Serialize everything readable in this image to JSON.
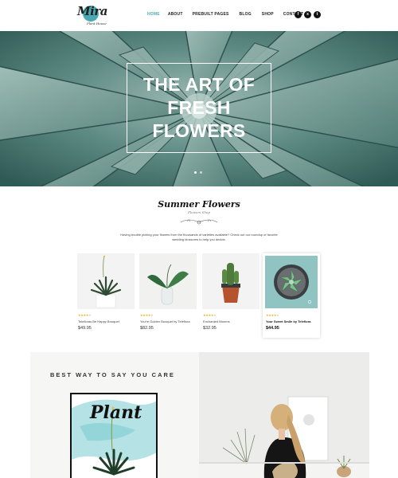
{
  "header": {
    "logo_text": "Mira",
    "logo_sub": "Plant House",
    "nav": [
      "HOME",
      "ABOUT",
      "PREBUILT PAGES",
      "BLOG",
      "SHOP",
      "CONTACT"
    ],
    "social_icons": [
      "facebook-icon",
      "xing-icon",
      "twitter-icon"
    ]
  },
  "hero": {
    "title": "THE ART OF FRESH FLOWERS",
    "slide_count": 2,
    "active_slide": 1
  },
  "summer": {
    "title": "Summer Flowers",
    "subtitle": "Flowers Shop",
    "description": "Having trouble picking your flowers from the thousands of varieties available? Check out our roundup of favorite wedding blossoms to help you decide."
  },
  "products": [
    {
      "name": "Telefloras Be Happy Bouquet",
      "price": "$49.95",
      "rating": 4
    },
    {
      "name": "You're Golden Bouquet by Teleflora",
      "price": "$82.95",
      "rating": 4
    },
    {
      "name": "Enchanted Blooms",
      "price": "$32.95",
      "rating": 4
    },
    {
      "name": "Your Sweet Smile by Teleflora",
      "price": "$44.95",
      "rating": 4
    }
  ],
  "bottom": {
    "title": "BEST WAY TO SAY YOU CARE",
    "plant_word": "Plant"
  },
  "colors": {
    "accent": "#4aa9b3",
    "hero_bg": "#6c8f8a",
    "star": "#e6b422"
  }
}
